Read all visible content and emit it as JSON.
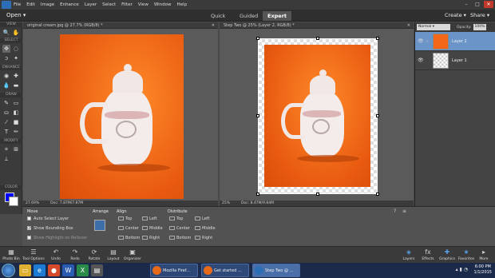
{
  "menubar": {
    "items": [
      "File",
      "Edit",
      "Image",
      "Enhance",
      "Layer",
      "Select",
      "Filter",
      "View",
      "Window",
      "Help"
    ]
  },
  "modebar": {
    "open_label": "Open",
    "tabs": [
      "Quick",
      "Guided",
      "Expert"
    ],
    "active_tab": "Expert",
    "create_label": "Create",
    "share_label": "Share"
  },
  "toolbox": {
    "sections": [
      "VIEW",
      "SELECT",
      "ENHANCE",
      "DRAW",
      "MODIFY",
      "COLOR"
    ]
  },
  "doc1": {
    "tab_title": "original cream.jpg @ 27.7% (RGB/8) *",
    "zoom": "27.69%",
    "doc_size": "Doc: 7.87M/7.87M"
  },
  "doc2": {
    "tab_title": "Step Two @ 25% (Layer 2, RGB/8) *",
    "zoom": "25%",
    "doc_size": "Doc: 8.47M/9.84M"
  },
  "layers": {
    "blend_mode": "Normal",
    "opacity_label": "Opacity:",
    "opacity_value": "100%",
    "items": [
      {
        "name": "Layer 2"
      },
      {
        "name": "Layer 1"
      }
    ]
  },
  "options": {
    "tool_name": "Move",
    "auto_select": "Auto Select Layer",
    "show_bbox": "Show Bounding Box",
    "show_highlight": "Show Highlight on Rollover",
    "arrange": "Arrange",
    "align": "Align",
    "distribute": "Distribute",
    "align_items": [
      "Top",
      "Center",
      "Bottom",
      "Left",
      "Middle",
      "Right"
    ],
    "distribute_items": [
      "Top",
      "Center",
      "Bottom",
      "Left",
      "Middle",
      "Right"
    ]
  },
  "bottombar": {
    "left": [
      "Photo Bin",
      "Tool Options",
      "Undo",
      "Redo",
      "Rotate",
      "Layout",
      "Organizer"
    ],
    "right": [
      "Layers",
      "Effects",
      "Graphics",
      "Favorites",
      "More"
    ]
  },
  "taskbar": {
    "items": [
      "Mozilla Firef...",
      "Get started ...",
      "Step Two @ ..."
    ],
    "time": "6:00 PM",
    "date": "1/1/2015"
  },
  "colors": {
    "accent": "#2c6fb7",
    "photo_bg": "#f26718",
    "layer_selected": "#6b95c9",
    "foreground": "#0000ff"
  }
}
